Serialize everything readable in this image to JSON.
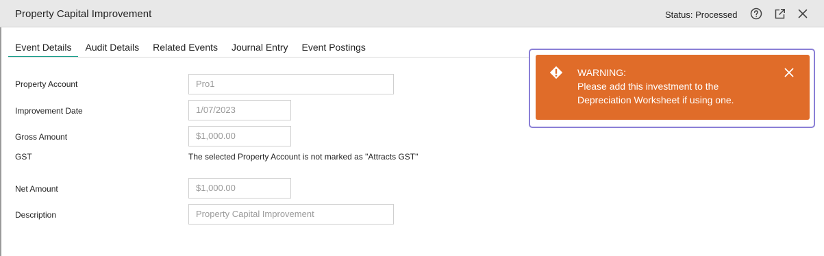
{
  "window": {
    "title": "Property Capital Improvement",
    "status": "Status: Processed",
    "icons": [
      "help-icon",
      "open-external-icon",
      "close-icon"
    ]
  },
  "tabs": [
    {
      "label": "Event Details",
      "active": true
    },
    {
      "label": "Audit Details",
      "active": false
    },
    {
      "label": "Related Events",
      "active": false
    },
    {
      "label": "Journal Entry",
      "active": false
    },
    {
      "label": "Event Postings",
      "active": false
    }
  ],
  "form": {
    "property_account": {
      "label": "Property Account",
      "value": "Pro1"
    },
    "improvement_date": {
      "label": "Improvement Date",
      "value": "1/07/2023"
    },
    "gross_amount": {
      "label": "Gross Amount",
      "value": "$1,000.00"
    },
    "gst": {
      "label": "GST",
      "note": "The selected Property Account is not marked as \"Attracts GST\""
    },
    "net_amount": {
      "label": "Net Amount",
      "value": "$1,000.00"
    },
    "description": {
      "label": "Description",
      "value": "Property Capital Improvement"
    }
  },
  "toast": {
    "heading": "WARNING:",
    "message": "Please add this investment to the Depreciation Worksheet if using one.",
    "icon": "warning-diamond-icon",
    "close_icon": "close-icon"
  },
  "colors": {
    "accent": "#1a9e8a",
    "warning": "#e06c29",
    "focus_outline": "#8a7fd6",
    "titlebar": "#e8e8e8"
  }
}
